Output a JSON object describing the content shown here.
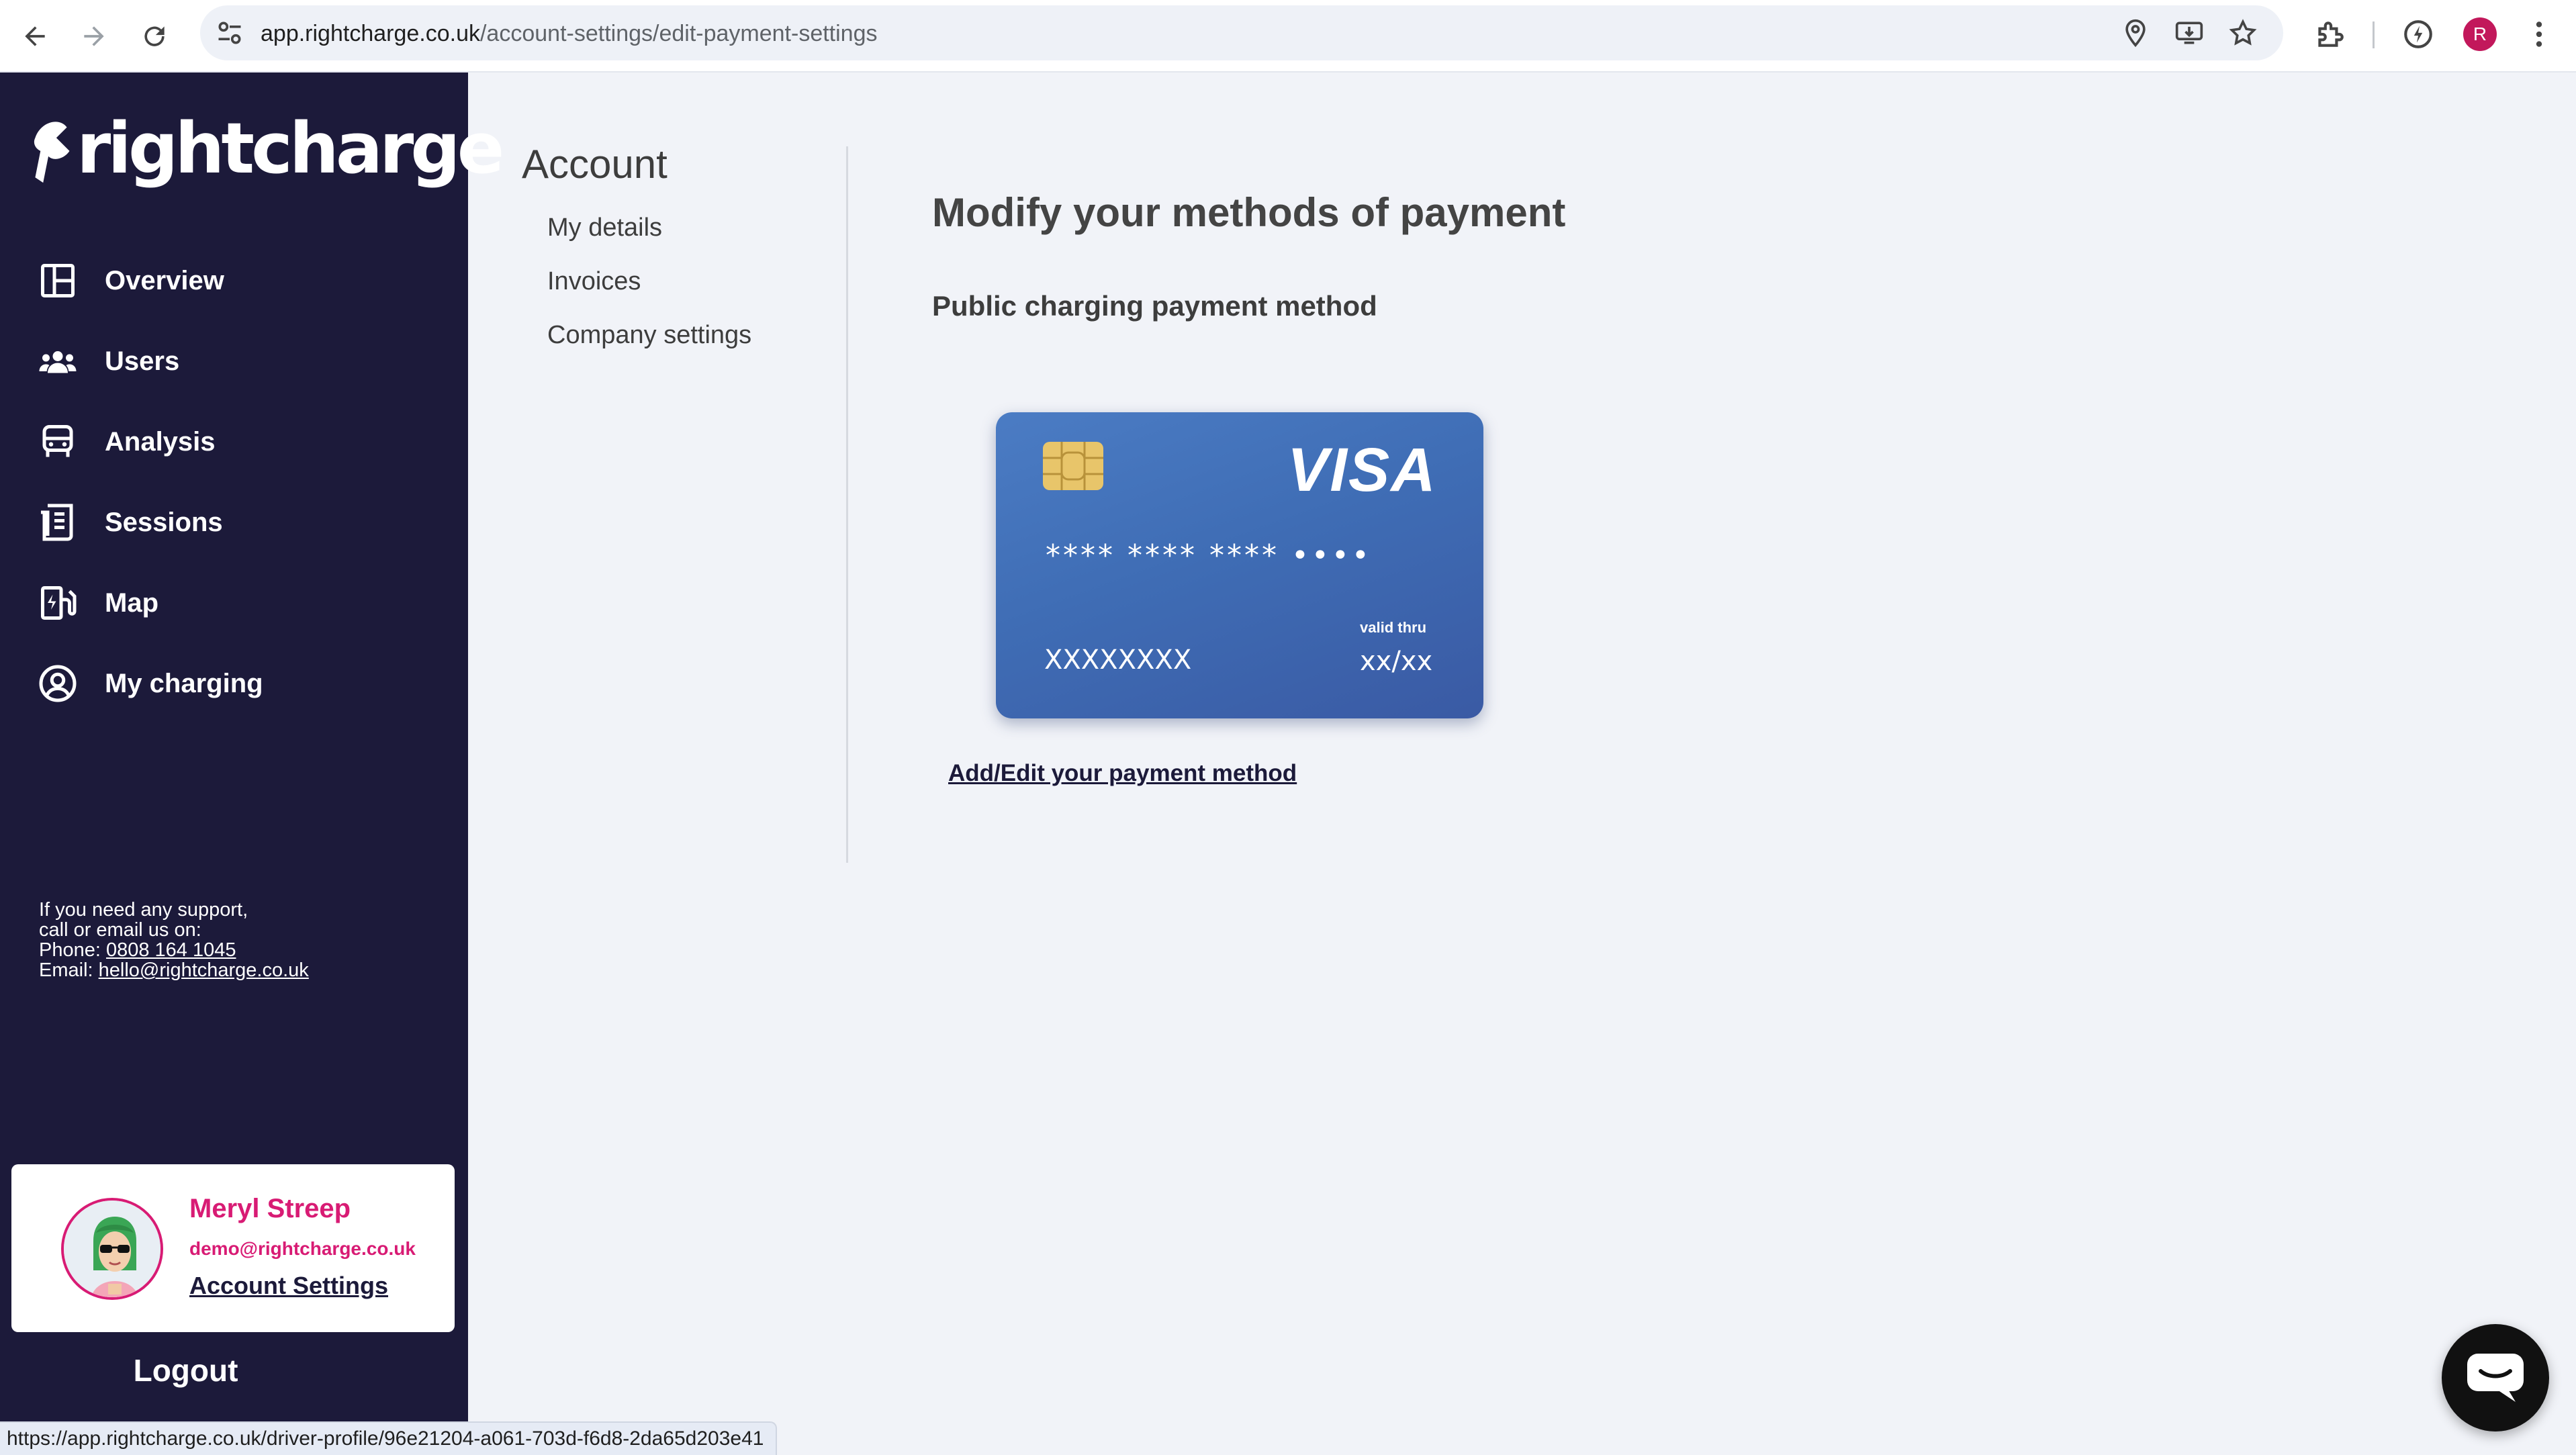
{
  "browser": {
    "url_host": "app.rightcharge.co.uk",
    "url_path": "/account-settings/edit-payment-settings",
    "profile_initial": "R",
    "status_url": "https://app.rightcharge.co.uk/driver-profile/96e21204-a061-703d-f6d8-2da65d203e41"
  },
  "sidebar": {
    "logo_text": "rightcharge",
    "items": [
      {
        "label": "Overview",
        "icon": "layout-icon"
      },
      {
        "label": "Users",
        "icon": "users-icon"
      },
      {
        "label": "Analysis",
        "icon": "car-icon"
      },
      {
        "label": "Sessions",
        "icon": "receipt-icon"
      },
      {
        "label": "Map",
        "icon": "charging-station-icon"
      },
      {
        "label": "My charging",
        "icon": "user-circle-icon"
      }
    ],
    "support": {
      "line1": "If you need any support,",
      "line2": "call or email us on:",
      "phone_label": "Phone: ",
      "phone": "0808 164 1045",
      "email_label": "Email: ",
      "email": "hello@rightcharge.co.uk"
    },
    "user": {
      "name": "Meryl Streep",
      "email": "demo@rightcharge.co.uk",
      "account_link": "Account Settings"
    },
    "logout": "Logout"
  },
  "account_nav": {
    "title": "Account",
    "items": [
      "My details",
      "Invoices",
      "Company settings"
    ]
  },
  "main": {
    "title": "Modify your methods of payment",
    "section_title": "Public charging payment method",
    "card": {
      "brand": "VISA",
      "number": "**** **** **** ••••",
      "holder": "XXXXXXXX",
      "valid_label": "valid thru",
      "valid_value": "xx/xx"
    },
    "edit_link": "Add/Edit your payment method"
  },
  "colors": {
    "sidebar_bg": "#1c1a3a",
    "accent_pink": "#d81b74",
    "page_bg": "#f1f3f8",
    "card_blue": "#3f6db5"
  }
}
